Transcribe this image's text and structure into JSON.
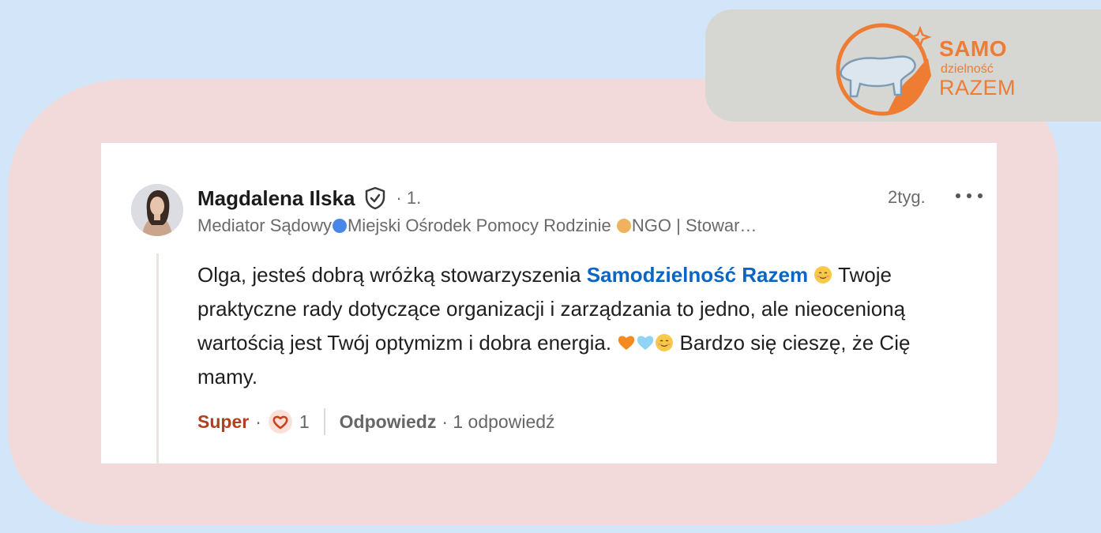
{
  "logo": {
    "line1": "SAMO",
    "line2": "dzielność",
    "line3": "RAZEM",
    "color": "#ef7c33"
  },
  "comment": {
    "author": "Magdalena Ilska",
    "verified_icon": "shield-check-icon",
    "degree": "· 1.",
    "timestamp": "2tyg.",
    "more_icon": "ellipsis-icon",
    "headline": {
      "part1": "Mediator Sądowy",
      "part2": "Miejski Ośrodek Pomocy Rodzinie ",
      "part3": "NGO | Stowar…"
    },
    "body": {
      "part1": "Olga, jesteś dobrą wróżką stowarzyszenia ",
      "mention": "Samodzielność Razem",
      "part2": " Twoje praktyczne rady dotyczące organizacji i zarządzania to jedno, ale nieocenioną wartością jest Twój optymizm i dobra energia. ",
      "part3": " Bardzo się cieszę, że Cię mamy."
    },
    "actions": {
      "reaction_label": "Super",
      "separator": "·",
      "reaction_icon": "heart-icon",
      "reaction_count": "1",
      "reply_label": "Odpowiedz",
      "replies": "· 1 odpowiedź"
    }
  },
  "colors": {
    "background": "#d3e6f9",
    "blob": "#f2dada",
    "logo_card": "#d6d6d3",
    "mention": "#0a66c2",
    "super": "#b24020"
  }
}
